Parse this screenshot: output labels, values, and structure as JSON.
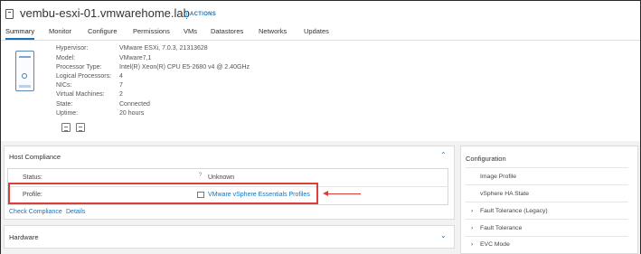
{
  "header": {
    "title": "vembu-esxi-01.vmwarehome.lab",
    "actions_label": "ACTIONS"
  },
  "tabs": [
    {
      "label": "Summary",
      "active": true
    },
    {
      "label": "Monitor"
    },
    {
      "label": "Configure"
    },
    {
      "label": "Permissions"
    },
    {
      "label": "VMs"
    },
    {
      "label": "Datastores"
    },
    {
      "label": "Networks"
    },
    {
      "label": "Updates"
    }
  ],
  "summary": {
    "rows": [
      {
        "label": "Hypervisor:",
        "value": "VMware ESXi, 7.0.3, 21313628"
      },
      {
        "label": "Model:",
        "value": "VMware7,1"
      },
      {
        "label": "Processor Type:",
        "value": "Intel(R) Xeon(R) CPU E5-2680 v4 @ 2.40GHz"
      },
      {
        "label": "Logical Processors:",
        "value": "4"
      },
      {
        "label": "NICs:",
        "value": "7"
      },
      {
        "label": "Virtual Machines:",
        "value": "2"
      },
      {
        "label": "State:",
        "value": "Connected"
      },
      {
        "label": "Uptime:",
        "value": "20 hours"
      }
    ]
  },
  "host_compliance": {
    "title": "Host Compliance",
    "status_label": "Status:",
    "status_value": "Unknown",
    "profile_label": "Profile:",
    "profile_value": "VMware vSphere Essentials Profiles",
    "check_compliance_link": "Check Compliance",
    "details_link": "Details"
  },
  "hardware": {
    "title": "Hardware"
  },
  "configuration": {
    "title": "Configuration",
    "items": [
      {
        "label": "Image Profile"
      },
      {
        "label": "vSphere HA State"
      },
      {
        "label": "Fault Tolerance (Legacy)",
        "expandable": true
      },
      {
        "label": "Fault Tolerance",
        "expandable": true
      },
      {
        "label": "EVC Mode",
        "expandable": true
      }
    ]
  },
  "colors": {
    "accent": "#1a73b8",
    "annotation": "#d9403a"
  },
  "icons": {
    "host": "host-icon",
    "actions": "actions-dots-icon",
    "server": "server-graphic-icon",
    "chevron_up": "chevron-up-icon",
    "chevron_down": "chevron-down-icon",
    "chevron_right": "chevron-right-icon",
    "help": "help-icon",
    "profile": "host-profile-icon"
  }
}
